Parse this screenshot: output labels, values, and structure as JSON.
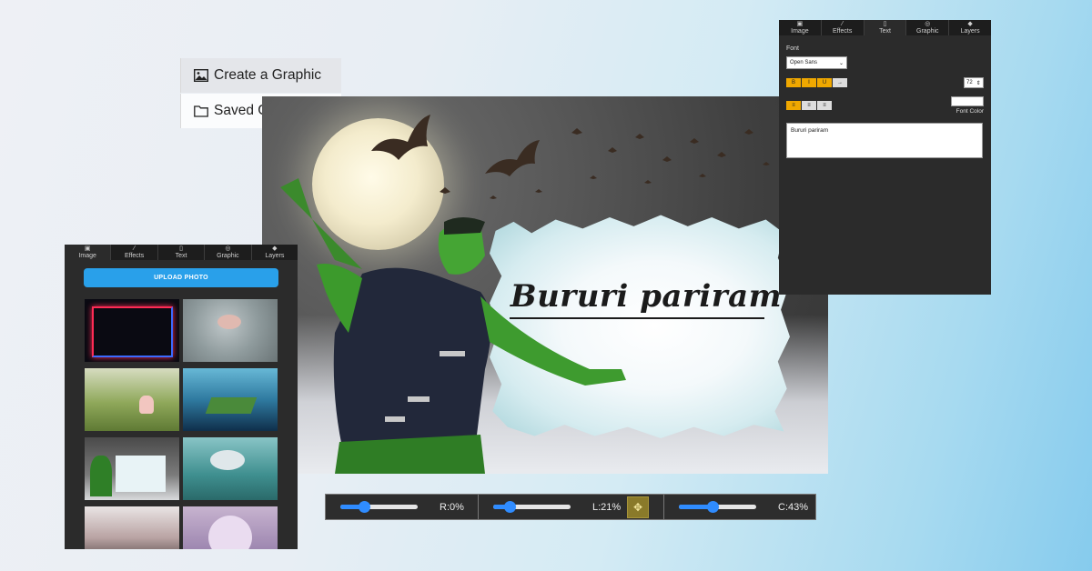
{
  "menu": {
    "create_label": "Create a Graphic",
    "saved_label": "Saved Graphics"
  },
  "canvas": {
    "headline": "Bururi pariram"
  },
  "sliders": [
    {
      "label": "R:0%",
      "value": 0.3
    },
    {
      "label": "L:21%",
      "value": 0.21
    },
    {
      "label": "C:43%",
      "value": 0.43
    }
  ],
  "left_panel": {
    "tabs": [
      "Image",
      "Effects",
      "Text",
      "Graphic",
      "Layers"
    ],
    "active_tab": "Image",
    "upload_label": "UPLOAD PHOTO"
  },
  "right_panel": {
    "tabs": [
      "Image",
      "Effects",
      "Text",
      "Graphic",
      "Layers"
    ],
    "active_tab": "Text",
    "font_label": "Font",
    "font_value": "Open Sans",
    "format_buttons": [
      "B",
      "I",
      "U",
      "→"
    ],
    "size_value": "72",
    "align_buttons": [
      "≡",
      "≡",
      "≡"
    ],
    "font_color_label": "Font Color",
    "text_value": "Bururi pariram"
  },
  "colors": {
    "accent_blue": "#29a0ea",
    "accent_orange": "#f0a800",
    "panel_bg": "#2b2b2b"
  }
}
